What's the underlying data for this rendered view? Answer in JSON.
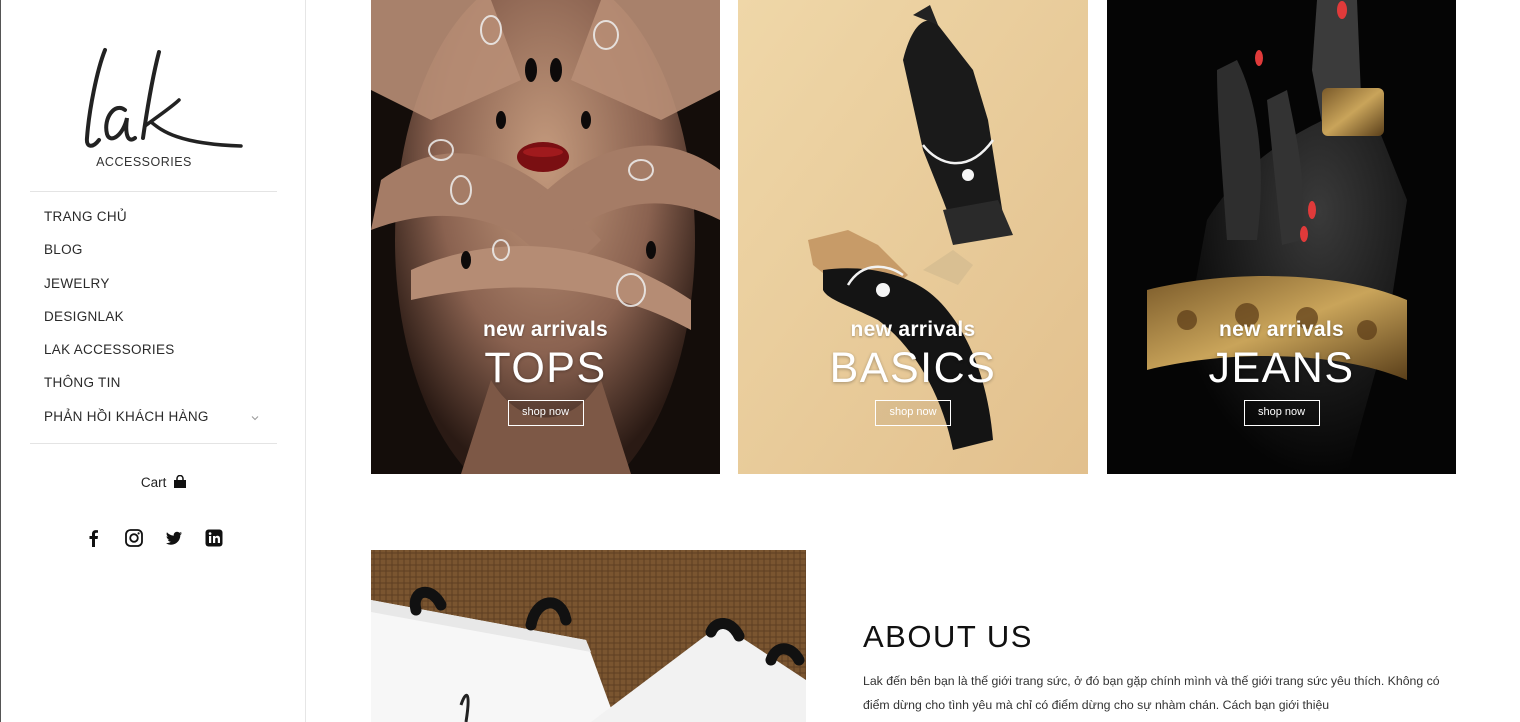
{
  "brand": {
    "logo_text": "lak",
    "sub": "ACCESSORIES"
  },
  "nav": [
    {
      "label": "TRANG CHỦ"
    },
    {
      "label": "BLOG"
    },
    {
      "label": "JEWELRY"
    },
    {
      "label": "DESIGNLAK"
    },
    {
      "label": "LAK ACCESSORIES"
    },
    {
      "label": "THÔNG TIN"
    },
    {
      "label": "PHẢN HỒI KHÁCH HÀNG",
      "has_submenu": true
    }
  ],
  "cart": {
    "label": "Cart",
    "icon": "shopping-bag-icon"
  },
  "social": [
    "facebook-icon",
    "instagram-icon",
    "twitter-icon",
    "linkedin-icon"
  ],
  "cards": [
    {
      "eyebrow": "new arrivals",
      "title": "TOPS",
      "button": "shop now"
    },
    {
      "eyebrow": "new arrivals",
      "title": "BASICS",
      "button": "shop now"
    },
    {
      "eyebrow": "new arrivals",
      "title": "JEANS",
      "button": "shop now"
    }
  ],
  "about": {
    "title": "ABOUT US",
    "body": "Lak đến bên bạn là thế giới trang sức, ở đó bạn gặp chính mình và thế giới trang sức yêu thích. Không có điểm dừng cho tình yêu mà chỉ có điểm dừng cho sự nhàm chán. Cách bạn giới thiệu"
  },
  "colors": {
    "text": "#222222",
    "divider": "#e4e4e4",
    "nail_red": "#e03a3a"
  }
}
